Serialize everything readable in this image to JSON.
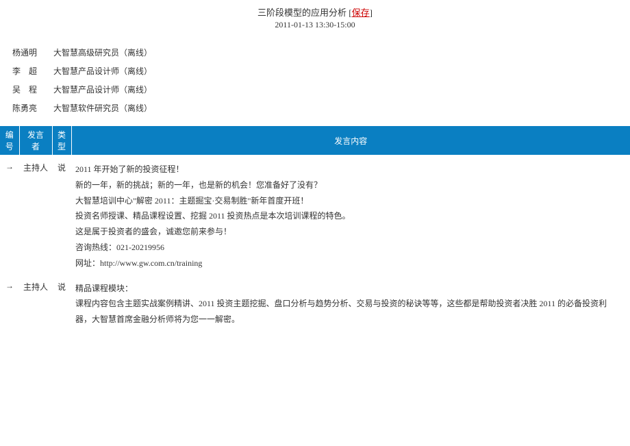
{
  "header": {
    "title": "三阶段模型的应用分析",
    "save_label": "保存",
    "datetime": "2011-01-13 13:30-15:00"
  },
  "participants": [
    {
      "name": "杨通明",
      "spaced": false,
      "role": "大智慧高级研究员（离线）"
    },
    {
      "name": "李超",
      "spaced": true,
      "role": "大智慧产品设计师（离线）"
    },
    {
      "name": "吴程",
      "spaced": true,
      "role": "大智慧产品设计师（离线）"
    },
    {
      "name": "陈勇亮",
      "spaced": false,
      "role": "大智慧软件研究员（离线）"
    }
  ],
  "table": {
    "headers": {
      "id": "编号",
      "speaker": "发言者",
      "type": "类型",
      "content": "发言内容"
    },
    "rows": [
      {
        "id": "→",
        "speaker": "主持人",
        "type": "说",
        "lines": [
          "2011 年开始了新的投资征程！",
          "新的一年，新的挑战；新的一年，也是新的机会！您准备好了没有？",
          "大智慧培训中心\"解密 2011：主题掘宝·交易制胜\"新年首度开班！",
          "投资名师授课、精品课程设置、挖掘 2011 投资热点是本次培训课程的特色。",
          "这是属于投资者的盛会，诚邀您前来参与！",
          "咨询热线：021-20219956",
          "网址：http://www.gw.com.cn/training"
        ]
      },
      {
        "id": "→",
        "speaker": "主持人",
        "type": "说",
        "lines": [
          "精品课程模块：",
          "课程内容包含主题实战案例精讲、2011 投资主题挖掘、盘口分析与趋势分析、交易与投资的秘诀等等，这些都是帮助投资者决胜 2011 的必备投资利器，大智慧首席金融分析师将为您一一解密。"
        ]
      }
    ]
  }
}
